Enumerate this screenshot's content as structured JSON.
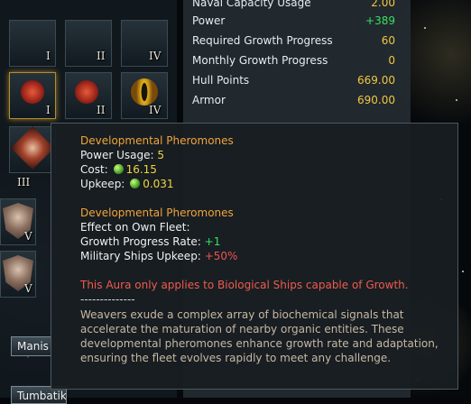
{
  "stats_panel": {
    "rows": [
      {
        "label": "Naval Capacity Usage",
        "value": "2.00",
        "color": "#f2c640"
      },
      {
        "label": "Power",
        "value": "+389",
        "color": "#36e060"
      },
      {
        "label": "Required Growth Progress",
        "value": "60",
        "color": "#f2c640"
      },
      {
        "label": "Monthly Growth Progress",
        "value": "0",
        "color": "#f2c640"
      },
      {
        "label": "Hull Points",
        "value": "669.00",
        "color": "#f2c640"
      },
      {
        "label": "Armor",
        "value": "690.00",
        "color": "#f2c640"
      }
    ]
  },
  "parts": {
    "slot_labels": [
      "I",
      "II",
      "IV",
      "I",
      "II",
      "IV",
      "III",
      "V",
      "V"
    ]
  },
  "tooltip": {
    "title1": "Developmental Pheromones",
    "power_usage_label": "Power Usage:",
    "power_usage_value": "5",
    "cost_label": "Cost:",
    "cost_value": "16.15",
    "upkeep_label": "Upkeep:",
    "upkeep_value": "0.031",
    "title2": "Developmental Pheromones",
    "effect_label": "Effect on Own Fleet:",
    "growth_label": "Growth Progress Rate:",
    "growth_value": "+1",
    "military_label": "Military Ships Upkeep:",
    "military_value": "+50%",
    "warning": "This Aura only applies to Biological Ships capable of Growth.",
    "separator": "--------------",
    "description": "Weavers exude a complex array of biochemical signals that accelerate the maturation of nearby organic entities. These developmental pheromones enhance growth rate and adaptation, ensuring the fleet evolves rapidly to meet any challenge.",
    "icon": "food-orb-icon"
  },
  "bottom": {
    "button1": "Manis De",
    "button2": "Tumbatika"
  },
  "colors": {
    "title": "#f1a43a",
    "highlight_yellow": "#f2d53c",
    "positive_green": "#36e060",
    "negative_red": "#f05454"
  }
}
